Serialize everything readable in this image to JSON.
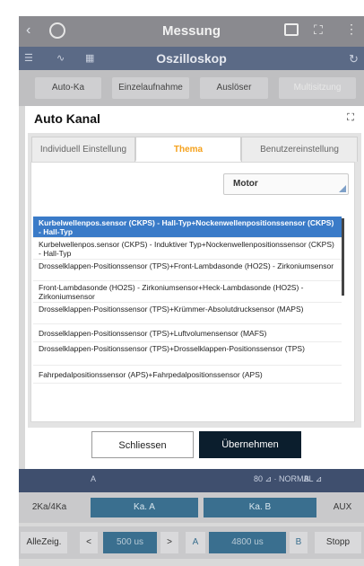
{
  "app": {
    "title": "Messung",
    "subtitle": "Oszilloskop",
    "toolbar_tabs": [
      "Auto-Ka",
      "Einzelaufnahme",
      "Auslöser",
      "Multisitzung"
    ]
  },
  "dialog": {
    "title": "Auto Kanal",
    "tabs": [
      {
        "label": "Individuell Einstellung",
        "active": false
      },
      {
        "label": "Thema",
        "active": true
      },
      {
        "label": "Benutzereinstellung",
        "active": false
      }
    ],
    "dropdown": {
      "selected": "Motor"
    },
    "items": [
      {
        "text": "Kurbelwellenpos.sensor (CKPS) - Hall-Typ+Nockenwellenpositionssensor (CKPS) - Hall-Typ",
        "selected": true
      },
      {
        "text": "Kurbelwellenpos.sensor (CKPS) - Induktiver Typ+Nockenwellenpositionssensor (CKPS) - Hall-Typ",
        "selected": false
      },
      {
        "text": "Drosselklappen-Positionssensor (TPS)+Front-Lambdasonde (HO2S) - Zirkoniumsensor",
        "selected": false
      },
      {
        "text": "Front-Lambdasonde (HO2S) - Zirkoniumsensor+Heck-Lambdasonde (HO2S) - Zirkoniumsensor",
        "selected": false
      },
      {
        "text": "Drosselklappen-Positionssensor (TPS)+Krümmer-Absolutdrucksensor (MAPS)",
        "selected": false
      },
      {
        "text": "Drosselklappen-Positionssensor (TPS)+Luftvolumensensor (MAFS)",
        "selected": false
      },
      {
        "text": "Drosselklappen-Positionssensor (TPS)+Drosselklappen-Positionssensor (TPS)",
        "selected": false
      },
      {
        "text": "Fahrpedalpositionssensor (APS)+Fahrpedalpositionssensor (APS)",
        "selected": false
      }
    ],
    "cancel_label": "Schliessen",
    "ok_label": "Übernehmen"
  },
  "scope": {
    "status": "80 ⊿ · NORMAL ⊿",
    "row1": [
      "2Ka/4Ka",
      "Ka. A",
      "Ka. B",
      "AUX"
    ],
    "row2": [
      "AlleZeig.",
      "<",
      "500 us",
      ">",
      "A",
      "4800 us",
      "B",
      "Stopp"
    ]
  },
  "colors": {
    "accent": "#f5a11c",
    "selection": "#3a7bc8",
    "primary_button": "#0b1e2d"
  }
}
